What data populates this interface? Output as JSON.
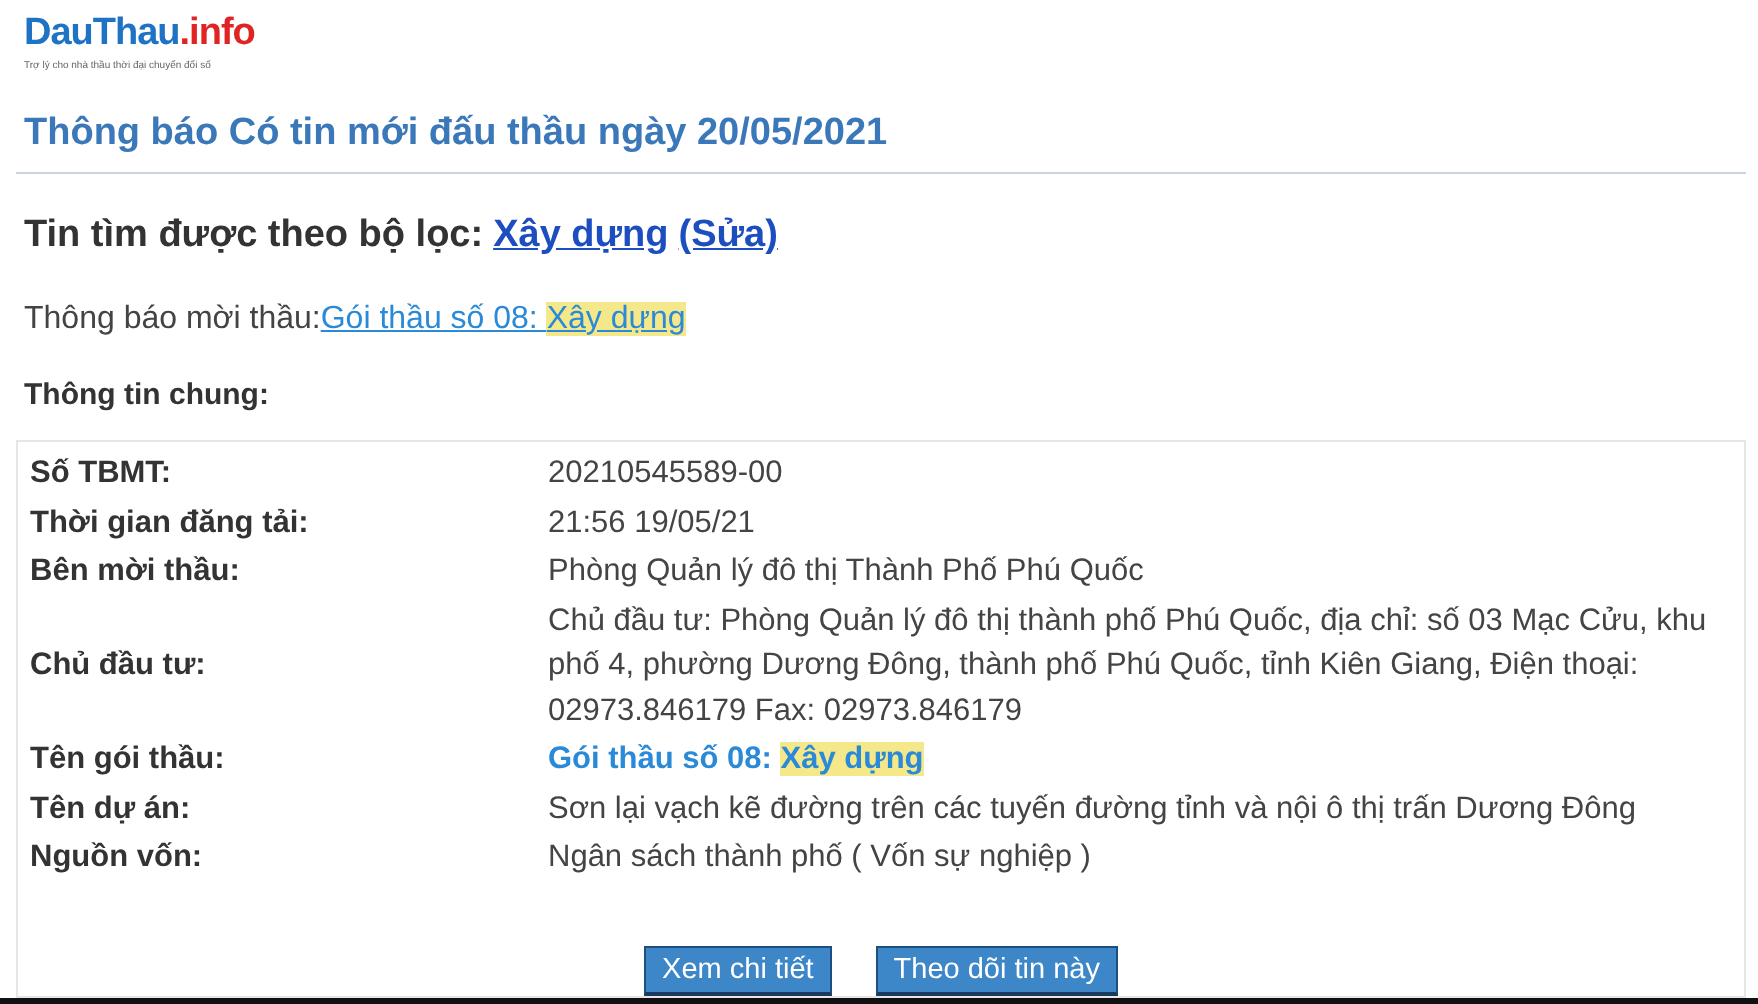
{
  "logo": {
    "brand_main": "DauThau",
    "brand_suffix": ".info",
    "tagline": "Trợ lý cho nhà thầu thời đại chuyển đổi số"
  },
  "title": "Thông báo Có tin mới đấu thầu ngày 20/05/2021",
  "filter": {
    "label": "Tin tìm được theo bộ lọc:",
    "value": "Xây dựng",
    "edit": "(Sửa)"
  },
  "notice": {
    "label": "Thông báo mời thầu:",
    "link": "Gói thầu số 08: ",
    "highlight": "Xây dựng"
  },
  "section": "Thông tin chung:",
  "rows": [
    {
      "label": "Số TBMT:",
      "kind": "text",
      "value": "20210545589-00"
    },
    {
      "label": "Thời gian đăng tải:",
      "kind": "text",
      "value": "21:56 19/05/21"
    },
    {
      "label": "Bên mời thầu:",
      "kind": "text",
      "value": "Phòng Quản lý đô thị Thành Phố Phú Quốc"
    },
    {
      "label": "Chủ đầu tư:",
      "kind": "text",
      "value": "Chủ đầu tư: Phòng Quản lý đô thị thành phố Phú Quốc, địa chỉ: số 03 Mạc Cửu, khu phố 4, phường Dương Đông, thành phố Phú Quốc, tỉnh Kiên Giang, Điện thoại: 02973.846179 Fax: 02973.846179"
    },
    {
      "label": "Tên gói thầu:",
      "kind": "link",
      "value": "Gói thầu số 08: ",
      "highlight": "Xây dựng"
    },
    {
      "label": "Tên dự án:",
      "kind": "text",
      "value": "Sơn lại vạch kẽ đường trên các tuyến đường tỉnh và nội ô thị trấn Dương Đông"
    },
    {
      "label": "Nguồn vốn:",
      "kind": "text",
      "value": "Ngân sách thành phố ( Vốn sự nghiệp )"
    }
  ],
  "buttons": [
    "Xem chi tiết",
    "Theo dõi tin này"
  ]
}
